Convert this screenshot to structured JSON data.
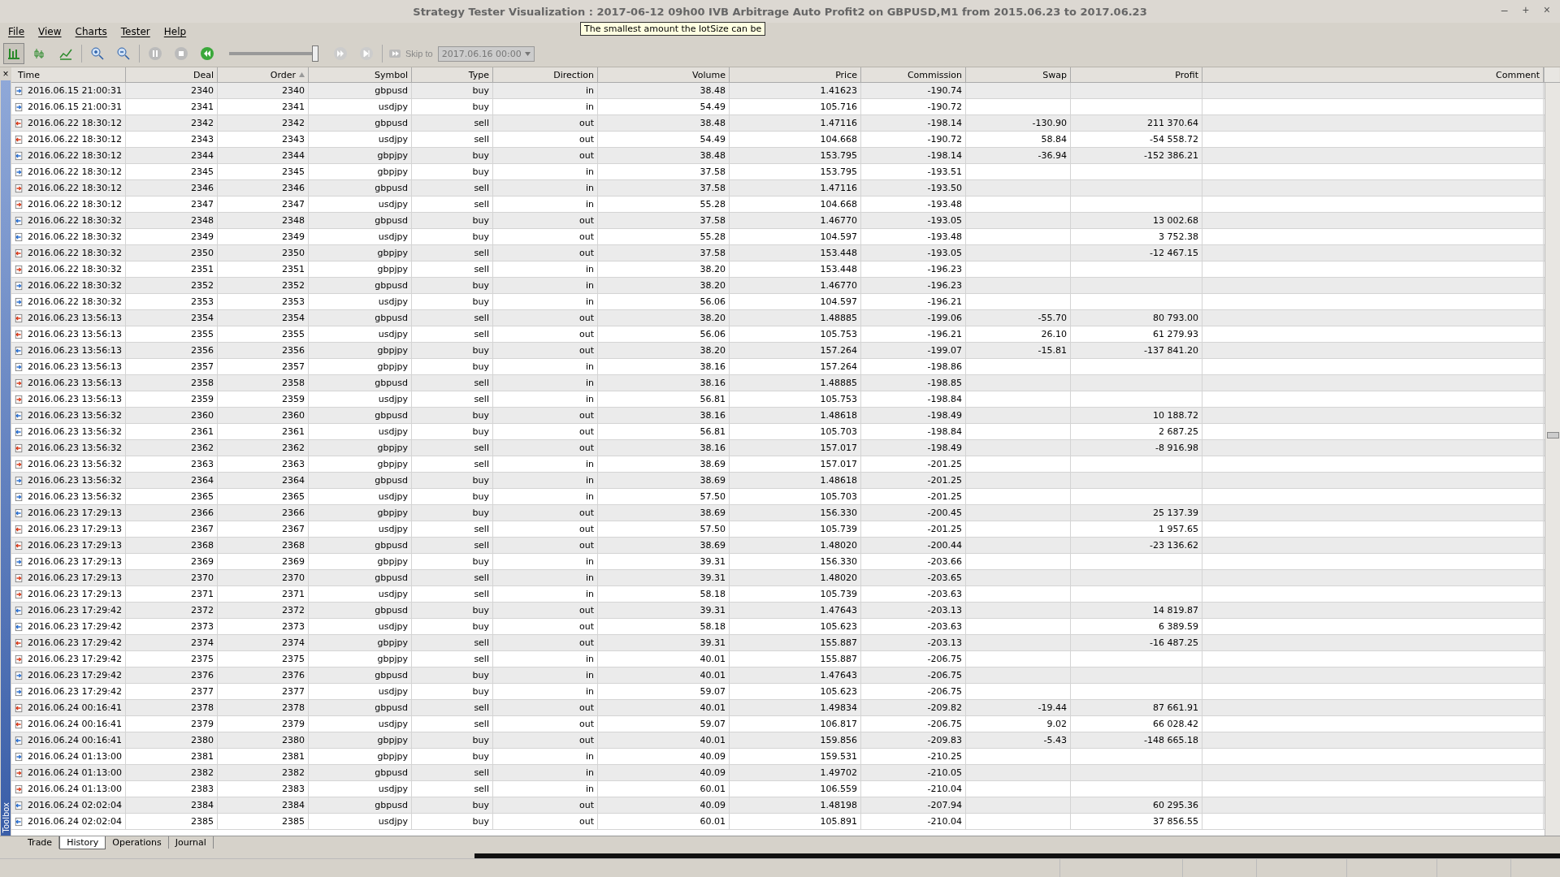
{
  "window": {
    "title": "Strategy Tester Visualization : 2017-06-12 09h00 IVB Arbitrage Auto Profit2 on GBPUSD,M1 from 2015.06.23 to 2017.06.23",
    "controls": [
      "–",
      "+",
      "×"
    ]
  },
  "tooltip": "The smallest amount the lotSize can be",
  "menu": [
    "File",
    "View",
    "Charts",
    "Tester",
    "Help"
  ],
  "toolbar": {
    "speed": {
      "level": 1
    },
    "skip_label": "Skip to",
    "skip_date": "2017.06.16 00:00"
  },
  "toolbox": {
    "label": "Toolbox",
    "close": "×"
  },
  "table": {
    "columns": [
      {
        "label": "Time",
        "sorted": false
      },
      {
        "label": "Deal",
        "sorted": false
      },
      {
        "label": "Order",
        "sorted": true
      },
      {
        "label": "Symbol",
        "sorted": false
      },
      {
        "label": "Type",
        "sorted": false
      },
      {
        "label": "Direction",
        "sorted": false
      },
      {
        "label": "Volume",
        "sorted": false
      },
      {
        "label": "Price",
        "sorted": false
      },
      {
        "label": "Commission",
        "sorted": false
      },
      {
        "label": "Swap",
        "sorted": false
      },
      {
        "label": "Profit",
        "sorted": false
      },
      {
        "label": "Comment",
        "sorted": false
      }
    ],
    "rows": [
      [
        "2016.06.15 21:00:31",
        "2340",
        "2340",
        "gbpusd",
        "buy",
        "in",
        "38.48",
        "1.41623",
        "-190.74",
        "",
        ""
      ],
      [
        "2016.06.15 21:00:31",
        "2341",
        "2341",
        "usdjpy",
        "buy",
        "in",
        "54.49",
        "105.716",
        "-190.72",
        "",
        ""
      ],
      [
        "2016.06.22 18:30:12",
        "2342",
        "2342",
        "gbpusd",
        "sell",
        "out",
        "38.48",
        "1.47116",
        "-198.14",
        "-130.90",
        "211 370.64"
      ],
      [
        "2016.06.22 18:30:12",
        "2343",
        "2343",
        "usdjpy",
        "sell",
        "out",
        "54.49",
        "104.668",
        "-190.72",
        "58.84",
        "-54 558.72"
      ],
      [
        "2016.06.22 18:30:12",
        "2344",
        "2344",
        "gbpjpy",
        "buy",
        "out",
        "38.48",
        "153.795",
        "-198.14",
        "-36.94",
        "-152 386.21"
      ],
      [
        "2016.06.22 18:30:12",
        "2345",
        "2345",
        "gbpjpy",
        "buy",
        "in",
        "37.58",
        "153.795",
        "-193.51",
        "",
        ""
      ],
      [
        "2016.06.22 18:30:12",
        "2346",
        "2346",
        "gbpusd",
        "sell",
        "in",
        "37.58",
        "1.47116",
        "-193.50",
        "",
        ""
      ],
      [
        "2016.06.22 18:30:12",
        "2347",
        "2347",
        "usdjpy",
        "sell",
        "in",
        "55.28",
        "104.668",
        "-193.48",
        "",
        ""
      ],
      [
        "2016.06.22 18:30:32",
        "2348",
        "2348",
        "gbpusd",
        "buy",
        "out",
        "37.58",
        "1.46770",
        "-193.05",
        "",
        "13 002.68"
      ],
      [
        "2016.06.22 18:30:32",
        "2349",
        "2349",
        "usdjpy",
        "buy",
        "out",
        "55.28",
        "104.597",
        "-193.48",
        "",
        "3 752.38"
      ],
      [
        "2016.06.22 18:30:32",
        "2350",
        "2350",
        "gbpjpy",
        "sell",
        "out",
        "37.58",
        "153.448",
        "-193.05",
        "",
        "-12 467.15"
      ],
      [
        "2016.06.22 18:30:32",
        "2351",
        "2351",
        "gbpjpy",
        "sell",
        "in",
        "38.20",
        "153.448",
        "-196.23",
        "",
        ""
      ],
      [
        "2016.06.22 18:30:32",
        "2352",
        "2352",
        "gbpusd",
        "buy",
        "in",
        "38.20",
        "1.46770",
        "-196.23",
        "",
        ""
      ],
      [
        "2016.06.22 18:30:32",
        "2353",
        "2353",
        "usdjpy",
        "buy",
        "in",
        "56.06",
        "104.597",
        "-196.21",
        "",
        ""
      ],
      [
        "2016.06.23 13:56:13",
        "2354",
        "2354",
        "gbpusd",
        "sell",
        "out",
        "38.20",
        "1.48885",
        "-199.06",
        "-55.70",
        "80 793.00"
      ],
      [
        "2016.06.23 13:56:13",
        "2355",
        "2355",
        "usdjpy",
        "sell",
        "out",
        "56.06",
        "105.753",
        "-196.21",
        "26.10",
        "61 279.93"
      ],
      [
        "2016.06.23 13:56:13",
        "2356",
        "2356",
        "gbpjpy",
        "buy",
        "out",
        "38.20",
        "157.264",
        "-199.07",
        "-15.81",
        "-137 841.20"
      ],
      [
        "2016.06.23 13:56:13",
        "2357",
        "2357",
        "gbpjpy",
        "buy",
        "in",
        "38.16",
        "157.264",
        "-198.86",
        "",
        ""
      ],
      [
        "2016.06.23 13:56:13",
        "2358",
        "2358",
        "gbpusd",
        "sell",
        "in",
        "38.16",
        "1.48885",
        "-198.85",
        "",
        ""
      ],
      [
        "2016.06.23 13:56:13",
        "2359",
        "2359",
        "usdjpy",
        "sell",
        "in",
        "56.81",
        "105.753",
        "-198.84",
        "",
        ""
      ],
      [
        "2016.06.23 13:56:32",
        "2360",
        "2360",
        "gbpusd",
        "buy",
        "out",
        "38.16",
        "1.48618",
        "-198.49",
        "",
        "10 188.72"
      ],
      [
        "2016.06.23 13:56:32",
        "2361",
        "2361",
        "usdjpy",
        "buy",
        "out",
        "56.81",
        "105.703",
        "-198.84",
        "",
        "2 687.25"
      ],
      [
        "2016.06.23 13:56:32",
        "2362",
        "2362",
        "gbpjpy",
        "sell",
        "out",
        "38.16",
        "157.017",
        "-198.49",
        "",
        "-8 916.98"
      ],
      [
        "2016.06.23 13:56:32",
        "2363",
        "2363",
        "gbpjpy",
        "sell",
        "in",
        "38.69",
        "157.017",
        "-201.25",
        "",
        ""
      ],
      [
        "2016.06.23 13:56:32",
        "2364",
        "2364",
        "gbpusd",
        "buy",
        "in",
        "38.69",
        "1.48618",
        "-201.25",
        "",
        ""
      ],
      [
        "2016.06.23 13:56:32",
        "2365",
        "2365",
        "usdjpy",
        "buy",
        "in",
        "57.50",
        "105.703",
        "-201.25",
        "",
        ""
      ],
      [
        "2016.06.23 17:29:13",
        "2366",
        "2366",
        "gbpjpy",
        "buy",
        "out",
        "38.69",
        "156.330",
        "-200.45",
        "",
        "25 137.39"
      ],
      [
        "2016.06.23 17:29:13",
        "2367",
        "2367",
        "usdjpy",
        "sell",
        "out",
        "57.50",
        "105.739",
        "-201.25",
        "",
        "1 957.65"
      ],
      [
        "2016.06.23 17:29:13",
        "2368",
        "2368",
        "gbpusd",
        "sell",
        "out",
        "38.69",
        "1.48020",
        "-200.44",
        "",
        "-23 136.62"
      ],
      [
        "2016.06.23 17:29:13",
        "2369",
        "2369",
        "gbpjpy",
        "buy",
        "in",
        "39.31",
        "156.330",
        "-203.66",
        "",
        ""
      ],
      [
        "2016.06.23 17:29:13",
        "2370",
        "2370",
        "gbpusd",
        "sell",
        "in",
        "39.31",
        "1.48020",
        "-203.65",
        "",
        ""
      ],
      [
        "2016.06.23 17:29:13",
        "2371",
        "2371",
        "usdjpy",
        "sell",
        "in",
        "58.18",
        "105.739",
        "-203.63",
        "",
        ""
      ],
      [
        "2016.06.23 17:29:42",
        "2372",
        "2372",
        "gbpusd",
        "buy",
        "out",
        "39.31",
        "1.47643",
        "-203.13",
        "",
        "14 819.87"
      ],
      [
        "2016.06.23 17:29:42",
        "2373",
        "2373",
        "usdjpy",
        "buy",
        "out",
        "58.18",
        "105.623",
        "-203.63",
        "",
        "6 389.59"
      ],
      [
        "2016.06.23 17:29:42",
        "2374",
        "2374",
        "gbpjpy",
        "sell",
        "out",
        "39.31",
        "155.887",
        "-203.13",
        "",
        "-16 487.25"
      ],
      [
        "2016.06.23 17:29:42",
        "2375",
        "2375",
        "gbpjpy",
        "sell",
        "in",
        "40.01",
        "155.887",
        "-206.75",
        "",
        ""
      ],
      [
        "2016.06.23 17:29:42",
        "2376",
        "2376",
        "gbpusd",
        "buy",
        "in",
        "40.01",
        "1.47643",
        "-206.75",
        "",
        ""
      ],
      [
        "2016.06.23 17:29:42",
        "2377",
        "2377",
        "usdjpy",
        "buy",
        "in",
        "59.07",
        "105.623",
        "-206.75",
        "",
        ""
      ],
      [
        "2016.06.24 00:16:41",
        "2378",
        "2378",
        "gbpusd",
        "sell",
        "out",
        "40.01",
        "1.49834",
        "-209.82",
        "-19.44",
        "87 661.91"
      ],
      [
        "2016.06.24 00:16:41",
        "2379",
        "2379",
        "usdjpy",
        "sell",
        "out",
        "59.07",
        "106.817",
        "-206.75",
        "9.02",
        "66 028.42"
      ],
      [
        "2016.06.24 00:16:41",
        "2380",
        "2380",
        "gbpjpy",
        "buy",
        "out",
        "40.01",
        "159.856",
        "-209.83",
        "-5.43",
        "-148 665.18"
      ],
      [
        "2016.06.24 01:13:00",
        "2381",
        "2381",
        "gbpjpy",
        "buy",
        "in",
        "40.09",
        "159.531",
        "-210.25",
        "",
        ""
      ],
      [
        "2016.06.24 01:13:00",
        "2382",
        "2382",
        "gbpusd",
        "sell",
        "in",
        "40.09",
        "1.49702",
        "-210.05",
        "",
        ""
      ],
      [
        "2016.06.24 01:13:00",
        "2383",
        "2383",
        "usdjpy",
        "sell",
        "in",
        "60.01",
        "106.559",
        "-210.04",
        "",
        ""
      ],
      [
        "2016.06.24 02:02:04",
        "2384",
        "2384",
        "gbpusd",
        "buy",
        "out",
        "40.09",
        "1.48198",
        "-207.94",
        "",
        "60 295.36"
      ],
      [
        "2016.06.24 02:02:04",
        "2385",
        "2385",
        "usdjpy",
        "buy",
        "out",
        "60.01",
        "105.891",
        "-210.04",
        "",
        "37 856.55"
      ]
    ]
  },
  "tabs": [
    {
      "label": "Trade",
      "selected": false
    },
    {
      "label": "History",
      "selected": true
    },
    {
      "label": "Operations",
      "selected": false
    },
    {
      "label": "Journal",
      "selected": false
    }
  ]
}
